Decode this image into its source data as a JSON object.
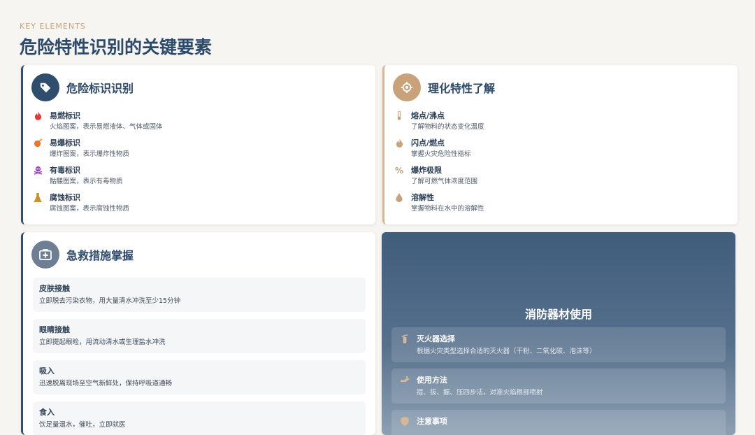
{
  "header": {
    "kicker": "KEY ELEMENTS",
    "title": "危险特性识别的关键要素"
  },
  "hazard_labels": {
    "title": "危险标识识别",
    "icon": "tags-icon",
    "items": [
      {
        "icon": "fire-icon",
        "color": "#e03b3b",
        "title": "易燃标识",
        "desc": "火焰图案，表示易燃液体、气体或固体"
      },
      {
        "icon": "bomb-icon",
        "color": "#e8772e",
        "title": "易爆标识",
        "desc": "爆炸图案，表示爆炸性物质"
      },
      {
        "icon": "skull-icon",
        "color": "#9b3fc4",
        "title": "有毒标识",
        "desc": "骷髅图案，表示有毒物质"
      },
      {
        "icon": "flask-icon",
        "color": "#c9912e",
        "title": "腐蚀标识",
        "desc": "腐蚀图案，表示腐蚀性物质"
      }
    ]
  },
  "properties": {
    "title": "理化特性了解",
    "icon": "atom-icon",
    "items": [
      {
        "icon": "thermometer-icon",
        "title": "熔点/沸点",
        "desc": "了解物料的状态变化温度"
      },
      {
        "icon": "flame-icon",
        "title": "闪点/燃点",
        "desc": "掌握火灾危险性指标"
      },
      {
        "icon": "percent-icon",
        "title": "爆炸极限",
        "desc": "了解可燃气体浓度范围"
      },
      {
        "icon": "droplet-icon",
        "title": "溶解性",
        "desc": "掌握物料在水中的溶解性"
      }
    ]
  },
  "first_aid": {
    "title": "急救措施掌握",
    "icon": "first-aid-icon",
    "items": [
      {
        "title": "皮肤接触",
        "desc": "立即脱去污染衣物，用大量清水冲洗至少15分钟"
      },
      {
        "title": "眼睛接触",
        "desc": "立即提起眼睑，用流动清水或生理盐水冲洗"
      },
      {
        "title": "吸入",
        "desc": "迅速脱离现场至空气新鲜处，保持呼吸道通畅"
      },
      {
        "title": "食入",
        "desc": "饮足量温水，催吐，立即就医"
      }
    ]
  },
  "fire_equipment": {
    "title": "消防器材使用",
    "items": [
      {
        "icon": "extinguisher-icon",
        "title": "灭火器选择",
        "desc": "根据火灾类型选择合适的灭火器（干粉、二氧化碳、泡沫等）"
      },
      {
        "icon": "hand-icon",
        "title": "使用方法",
        "desc": "提、拔、握、压四步法，对准火焰根部喷射"
      },
      {
        "icon": "shield-icon",
        "title": "注意事项",
        "desc": ""
      }
    ]
  },
  "colors": {
    "navy": "#2f4e6e",
    "tan": "#c9a27a",
    "tan_icon": "#c9a27a"
  }
}
